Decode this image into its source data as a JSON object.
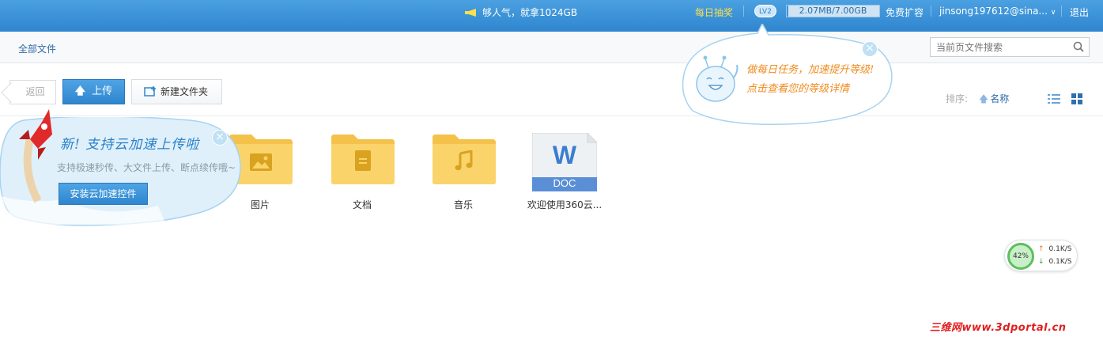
{
  "topbar": {
    "promo_text": "够人气，就拿1024GB",
    "lottery": "每日抽奖",
    "level": "LV2",
    "storage_text": "2.07MB/7.00GB",
    "storage_fraction": 0.0003,
    "expand": "免费扩容",
    "username": "jinsong197612@sina...",
    "logout": "退出"
  },
  "pathbar": {
    "all_files": "全部文件",
    "search_placeholder": "当前页文件搜索"
  },
  "toolbar": {
    "back": "返回",
    "upload": "上传",
    "new_folder": "新建文件夹",
    "sort_label": "排序:",
    "sort_field": "名称"
  },
  "files": [
    {
      "name": "图片",
      "type": "folder",
      "icon": "image-icon"
    },
    {
      "name": "文档",
      "type": "folder",
      "icon": "document-icon"
    },
    {
      "name": "音乐",
      "type": "folder",
      "icon": "music-icon"
    },
    {
      "name": "欢迎使用360云...",
      "type": "doc",
      "badge": "DOC",
      "letter": "W"
    }
  ],
  "tip_accelerate": {
    "title": "新! 支持云加速上传啦",
    "desc": "支持极速秒传、大文件上传、断点续传哦~",
    "button": "安装云加速控件"
  },
  "tip_level": {
    "line1": "做每日任务，加速提升等级!",
    "line2": "点击查看您的等级详情"
  },
  "speed": {
    "percent": "42%",
    "up": "0.1K/S",
    "down": "0.1K/S"
  },
  "watermark": "三维网www.3dportal.cn",
  "colors": {
    "topbar": "#2f86cf",
    "accent": "#2e6aa6",
    "folder": "#f7cd5a",
    "orange": "#f08a1c"
  }
}
